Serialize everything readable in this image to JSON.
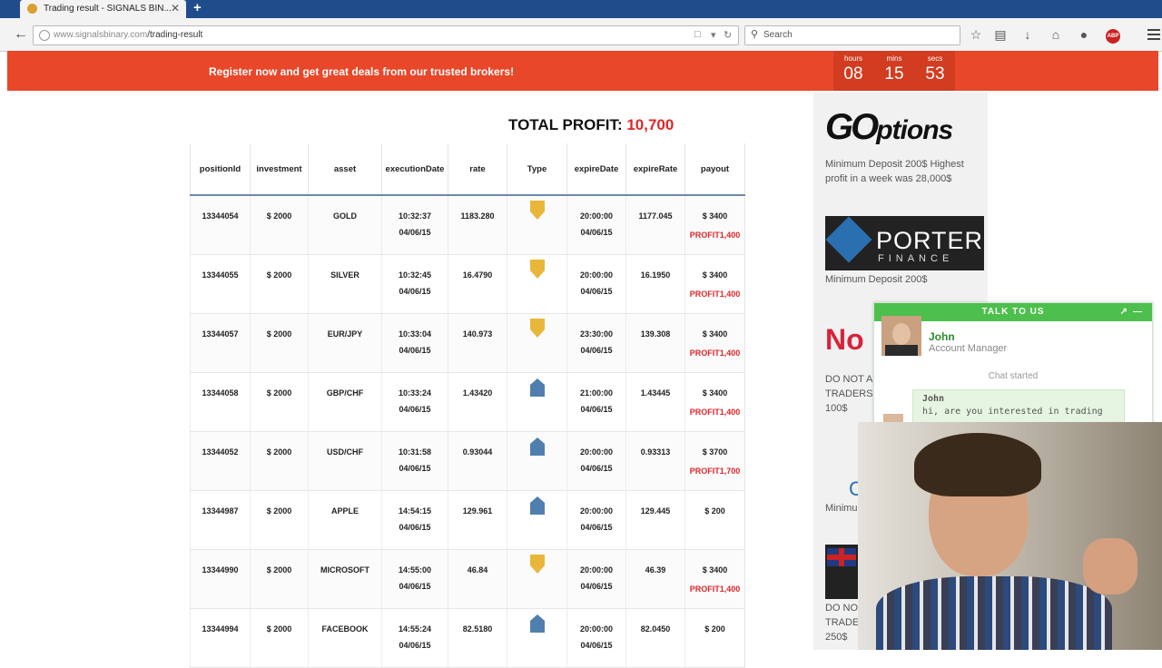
{
  "browser": {
    "tab_title": "Trading result - SIGNALS BIN...",
    "tab_close": "✕",
    "new_tab": "+",
    "url_host": "www.signalsbinary.com",
    "url_path": "/trading-result",
    "search_placeholder": "Search",
    "abp_label": "ABP"
  },
  "banner": {
    "message": "Register now and get great deals from our trusted brokers!",
    "timer": [
      {
        "label": "hours",
        "value": "08"
      },
      {
        "label": "mins",
        "value": "15"
      },
      {
        "label": "secs",
        "value": "53"
      }
    ]
  },
  "summary": {
    "label": "TOTAL PROFIT:",
    "value": "10,700"
  },
  "table": {
    "headers": [
      "positionId",
      "investment",
      "asset",
      "executionDate",
      "rate",
      "Type",
      "expireDate",
      "expireRate",
      "payout"
    ],
    "rows": [
      {
        "id": "13344054",
        "investment": "$ 2000",
        "asset": "GOLD",
        "exec_time": "10:32:37",
        "exec_date": "04/06/15",
        "rate": "1183.280",
        "type": "down",
        "expire_time": "20:00:00",
        "expire_date": "04/06/15",
        "expire_rate": "1177.045",
        "payout": "$ 3400",
        "profit": "PROFIT1,400"
      },
      {
        "id": "13344055",
        "investment": "$ 2000",
        "asset": "SILVER",
        "exec_time": "10:32:45",
        "exec_date": "04/06/15",
        "rate": "16.4790",
        "type": "down",
        "expire_time": "20:00:00",
        "expire_date": "04/06/15",
        "expire_rate": "16.1950",
        "payout": "$ 3400",
        "profit": "PROFIT1,400"
      },
      {
        "id": "13344057",
        "investment": "$ 2000",
        "asset": "EUR/JPY",
        "exec_time": "10:33:04",
        "exec_date": "04/06/15",
        "rate": "140.973",
        "type": "down",
        "expire_time": "23:30:00",
        "expire_date": "04/06/15",
        "expire_rate": "139.308",
        "payout": "$ 3400",
        "profit": "PROFIT1,400"
      },
      {
        "id": "13344058",
        "investment": "$ 2000",
        "asset": "GBP/CHF",
        "exec_time": "10:33:24",
        "exec_date": "04/06/15",
        "rate": "1.43420",
        "type": "up",
        "expire_time": "21:00:00",
        "expire_date": "04/06/15",
        "expire_rate": "1.43445",
        "payout": "$ 3400",
        "profit": "PROFIT1,400"
      },
      {
        "id": "13344052",
        "investment": "$ 2000",
        "asset": "USD/CHF",
        "exec_time": "10:31:58",
        "exec_date": "04/06/15",
        "rate": "0.93044",
        "type": "up",
        "expire_time": "20:00:00",
        "expire_date": "04/06/15",
        "expire_rate": "0.93313",
        "payout": "$ 3700",
        "profit": "PROFIT1,700"
      },
      {
        "id": "13344987",
        "investment": "$ 2000",
        "asset": "APPLE",
        "exec_time": "14:54:15",
        "exec_date": "04/06/15",
        "rate": "129.961",
        "type": "up",
        "expire_time": "20:00:00",
        "expire_date": "04/06/15",
        "expire_rate": "129.445",
        "payout": "$ 200",
        "profit": ""
      },
      {
        "id": "13344990",
        "investment": "$ 2000",
        "asset": "MICROSOFT",
        "exec_time": "14:55:00",
        "exec_date": "04/06/15",
        "rate": "46.84",
        "type": "down",
        "expire_time": "20:00:00",
        "expire_date": "04/06/15",
        "expire_rate": "46.39",
        "payout": "$ 3400",
        "profit": "PROFIT1,400"
      },
      {
        "id": "13344994",
        "investment": "$ 2000",
        "asset": "FACEBOOK",
        "exec_time": "14:55:24",
        "exec_date": "04/06/15",
        "rate": "82.5180",
        "type": "up",
        "expire_time": "20:00:00",
        "expire_date": "04/06/15",
        "expire_rate": "82.0450",
        "payout": "$ 200",
        "profit": ""
      }
    ]
  },
  "ads": {
    "go_logo": "GO",
    "go_logo_small": "ptions",
    "go_text_1": "Minimum Deposit 200$ Highest",
    "go_text_2": "profit in a week was 28,000$",
    "porter_name": "PORTER",
    "porter_sub": "FINANCE",
    "porter_text": "Minimum Deposit 200$",
    "nol_logo": "No",
    "nol_text_1": "DO NOT A",
    "nol_text_2": "TRADERS",
    "nol_text_3": "100$",
    "c_logo": "C",
    "c_text": "Minimu",
    "uk_text_1": "DO NO",
    "uk_text_2": "TRADE",
    "uk_text_3": "250$"
  },
  "chat": {
    "header": "TALK TO US",
    "popout": "↗",
    "minimize": "—",
    "agent_name": "John",
    "agent_role": "Account Manager",
    "status": "Chat started",
    "message_author": "John",
    "message_text": "hi, are you interested in trading"
  },
  "colors": {
    "banner": "#e8472a",
    "profit_red": "#e0262a",
    "chat_green": "#4cbf4c",
    "arrow_down": "#e8b73a",
    "arrow_up": "#4f7fae"
  }
}
